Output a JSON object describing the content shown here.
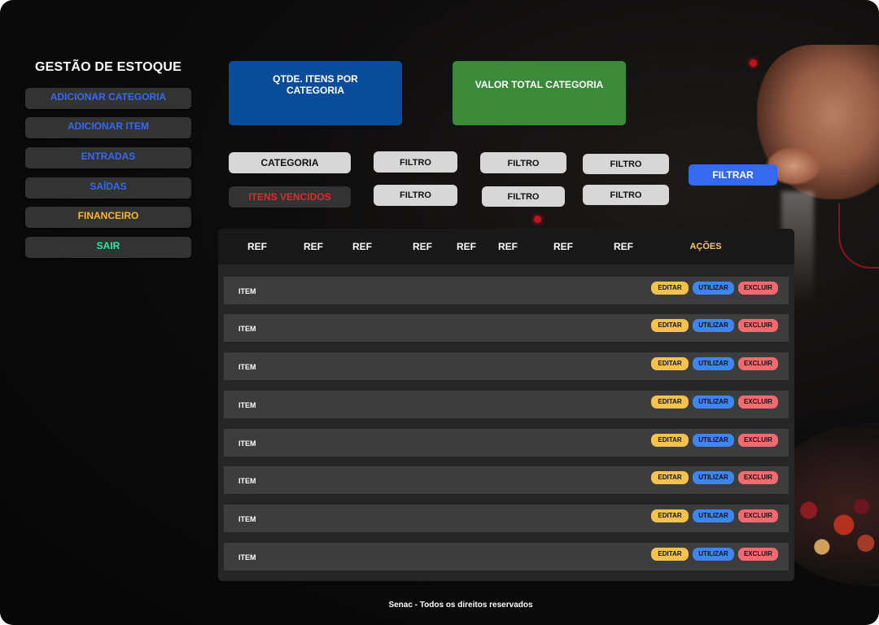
{
  "sidebar": {
    "title": "GESTÃO DE ESTOQUE",
    "items": [
      {
        "label": "ADICIONAR CATEGORIA",
        "color": "#3569ef"
      },
      {
        "label": "ADICIONAR ITEM",
        "color": "#3569ef"
      },
      {
        "label": "ENTRADAS",
        "color": "#3569ef"
      },
      {
        "label": "SAÍDAS",
        "color": "#3569ef"
      },
      {
        "label": "FINANCEIRO",
        "color": "#f5b82e"
      },
      {
        "label": "SAIR",
        "color": "#2ee6a6"
      }
    ]
  },
  "cards": {
    "qtde": {
      "line1": "QTDE.  ITENS POR",
      "line2": "CATEGORIA",
      "color": "#0a4c9c"
    },
    "valor": {
      "label": "VALOR TOTAL CATEGORIA",
      "color": "#3a8a39"
    }
  },
  "filters": {
    "categoria": "CATEGORIA",
    "vencidos": "ITENS VENCIDOS",
    "filtro": "FILTRO",
    "filtrar": "FILTRAR"
  },
  "table": {
    "headers": [
      "REF",
      "REF",
      "REF",
      "REF",
      "REF",
      "REF",
      "REF",
      "REF"
    ],
    "actions_header": "AÇÕES",
    "rows": [
      "ITEM",
      "ITEM",
      "ITEM",
      "ITEM",
      "ITEM",
      "ITEM",
      "ITEM",
      "ITEM"
    ],
    "actions": {
      "edit": "EDITAR",
      "use": "UTILIZAR",
      "delete": "EXCLUIR"
    }
  },
  "footer": "Senac - Todos os direitos reservados"
}
